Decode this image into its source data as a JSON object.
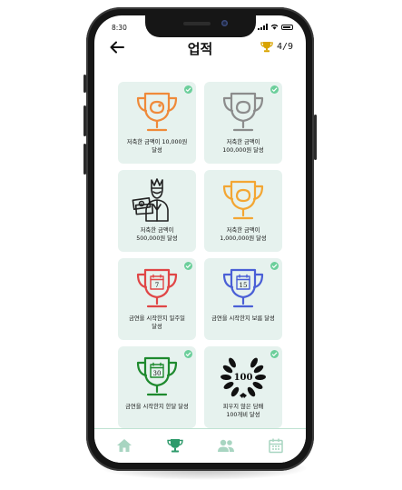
{
  "status": {
    "time": "8:30"
  },
  "header": {
    "title": "업적",
    "count": "4/9",
    "trophy_color": "#d9a400"
  },
  "cards": [
    {
      "label_line1": "저축한 금액이 10,000원",
      "label_line2": "달성",
      "color": "#ef8a3a",
      "icon": "piggy-bank-trophy",
      "done": true
    },
    {
      "label_line1": "저축한 금액이",
      "label_line2": "100,000원 달성",
      "color": "#8c8c8c",
      "icon": "piggy-bank-trophy",
      "done": true
    },
    {
      "label_line1": "저축한 금액이",
      "label_line2": "500,000원 달성",
      "color": "#222222",
      "icon": "king-with-money",
      "done": false
    },
    {
      "label_line1": "저축한 금액이",
      "label_line2": "1,000,000원 달성",
      "color": "#f3a633",
      "icon": "piggy-bank-trophy",
      "done": false
    },
    {
      "label_line1": "금연을 시작한지 일주일",
      "label_line2": "달성",
      "color": "#e04646",
      "icon": "calendar-trophy",
      "day": "7",
      "done": true
    },
    {
      "label_line1": "금연을 시작한지 보름 달성",
      "label_line2": "",
      "color": "#4a5fd6",
      "icon": "calendar-trophy",
      "day": "15",
      "done": true
    },
    {
      "label_line1": "금연을 시작한지 한달 달성",
      "label_line2": "",
      "color": "#1e8a2e",
      "icon": "calendar-trophy",
      "day": "30",
      "done": true
    },
    {
      "label_line1": "피우지 않은 담배",
      "label_line2": "100개비 달성",
      "color": "#111111",
      "icon": "laurel-wreath",
      "badge": "100",
      "done": true
    }
  ],
  "tabs": [
    {
      "name": "home",
      "active": false
    },
    {
      "name": "achievements",
      "active": true
    },
    {
      "name": "community",
      "active": false
    },
    {
      "name": "calendar",
      "active": false
    }
  ],
  "colors": {
    "accent": "#2e9a6b",
    "card_bg": "#e6f2ee",
    "check": "#6ccf9b",
    "inactive_tab": "#a8d5c1"
  }
}
